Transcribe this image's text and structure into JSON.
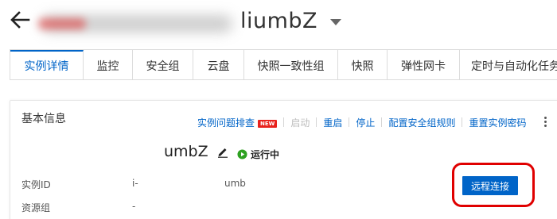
{
  "header": {
    "back_icon": "arrow-left-icon",
    "title_suffix": "liumbZ",
    "dropdown_icon": "caret-down-icon"
  },
  "tabs": [
    {
      "label": "实例详情",
      "active": true
    },
    {
      "label": "监控"
    },
    {
      "label": "安全组"
    },
    {
      "label": "云盘"
    },
    {
      "label": "快照一致性组"
    },
    {
      "label": "快照"
    },
    {
      "label": "弹性网卡"
    },
    {
      "label": "定时与自动化任务"
    }
  ],
  "basic_info": {
    "title": "基本信息",
    "actions": {
      "diagnose": "实例问题排查",
      "new_badge": "NEW",
      "start": "启动",
      "restart": "重启",
      "stop": "停止",
      "security_rules": "配置安全组规则",
      "reset_password": "重置实例密码"
    },
    "instance_name": "umbZ",
    "status": "运行中",
    "status_color": "#2ea121",
    "fields": {
      "instance_id_label": "实例ID",
      "instance_id_prefix": "i-",
      "instance_id_suffix": "umb",
      "resource_group_label": "资源组",
      "resource_group_value": "-"
    },
    "connect_button": "远程连接"
  },
  "colors": {
    "accent": "#0064c8",
    "highlight": "#e00000",
    "badge": "#e8211c"
  }
}
